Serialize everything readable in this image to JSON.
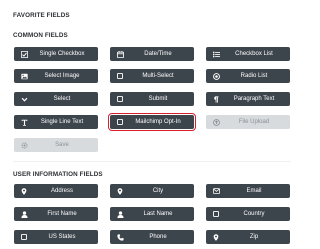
{
  "favorite_fields": {
    "heading": "FAVORITE FIELDS"
  },
  "common_fields": {
    "heading": "COMMON FIELDS",
    "items": [
      {
        "label": "Single Checkbox",
        "icon": "checkbox-checked-icon"
      },
      {
        "label": "Date/Time",
        "icon": "calendar-icon"
      },
      {
        "label": "Checkbox List",
        "icon": "list-icon"
      },
      {
        "label": "Select Image",
        "icon": "image-icon"
      },
      {
        "label": "Multi-Select",
        "icon": "square-icon"
      },
      {
        "label": "Radio List",
        "icon": "radio-icon"
      },
      {
        "label": "Select",
        "icon": "chevron-down-icon"
      },
      {
        "label": "Submit",
        "icon": "square-icon"
      },
      {
        "label": "Paragraph Text",
        "icon": "paragraph-icon"
      },
      {
        "label": "Single Line Text",
        "icon": "text-icon"
      },
      {
        "label": "Mailchimp Opt-In",
        "icon": "square-icon"
      },
      {
        "label": "File Upload",
        "icon": "upload-icon"
      },
      {
        "label": "Save",
        "icon": "gear-icon"
      }
    ]
  },
  "user_information_fields": {
    "heading": "USER INFORMATION FIELDS",
    "items": [
      {
        "label": "Address",
        "icon": "map-marker-icon"
      },
      {
        "label": "City",
        "icon": "map-marker-icon"
      },
      {
        "label": "Email",
        "icon": "envelope-icon"
      },
      {
        "label": "First Name",
        "icon": "user-icon"
      },
      {
        "label": "Last Name",
        "icon": "user-icon"
      },
      {
        "label": "Country",
        "icon": "square-icon"
      },
      {
        "label": "US States",
        "icon": "square-icon"
      },
      {
        "label": "Phone",
        "icon": "phone-icon"
      },
      {
        "label": "Zip",
        "icon": "map-marker-icon"
      }
    ]
  },
  "colors": {
    "button_bg": "#3c444c",
    "button_disabled_bg": "#d7dbde",
    "highlight_border": "#d91e2a"
  }
}
